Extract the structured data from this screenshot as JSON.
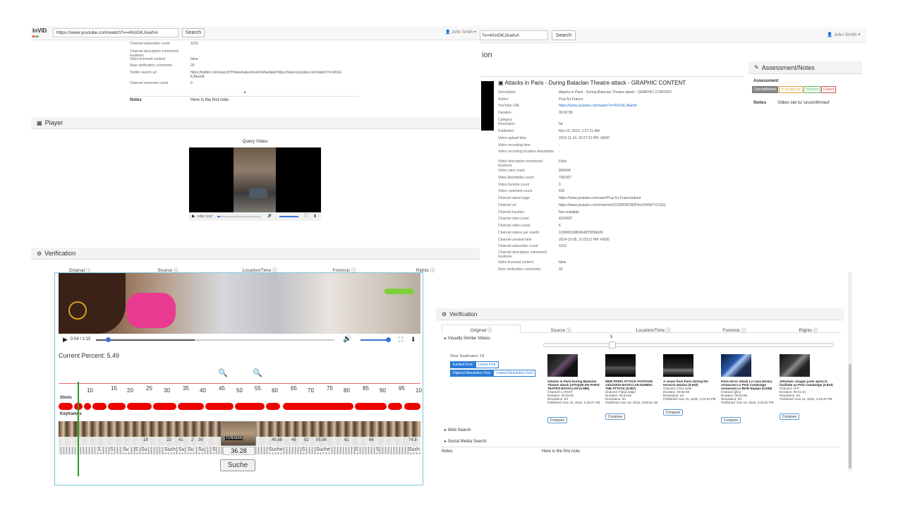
{
  "topbar": {
    "logo": "InVID",
    "url_value": "https://www.youtube.com/watch?v=4XnGKJAarhA",
    "search_label": "Search",
    "user": "John Smith"
  },
  "left_meta": {
    "rows": [
      {
        "k": "Channel subscriber count",
        "v": "1103"
      },
      {
        "k": "Channel description mentioned locations",
        "v": ""
      },
      {
        "k": "Video licensed content",
        "v": "false"
      },
      {
        "k": "Num verification comments",
        "v": "20"
      },
      {
        "k": "Twitter search url",
        "v": "https://twitter.com/search?f=tweets&vertical=default&q=https://www.youtube.com/watch?v=4XnGKJAarhA"
      },
      {
        "k": "Channel comment count",
        "v": "0"
      }
    ],
    "notes_label": "Notes",
    "notes_value": "Here is the first note."
  },
  "player": {
    "title": "Player",
    "caption": "Query Video",
    "time": "0:00 / 2:57"
  },
  "verification_left": {
    "title": "Verification",
    "tabs": [
      "Original",
      "Source",
      "Location/Time",
      "Forensic",
      "Rights"
    ]
  },
  "zoom": {
    "player_time": "0:04 / 1:15",
    "current_percent_label": "Current Percent: 5.49",
    "ruler": [
      "10",
      "15",
      "20",
      "25",
      "30",
      "35",
      "40",
      "45",
      "50",
      "55",
      "60",
      "65",
      "70",
      "75",
      "80",
      "85",
      "90",
      "95",
      "10"
    ],
    "shots_label": "Shots",
    "keyframes_label": "Keyframes",
    "frame_numbers": [
      "18",
      "23",
      "41",
      "2",
      "30",
      "36.28",
      "45.88",
      "49",
      "52",
      "55.56",
      "61",
      "66",
      "74.8"
    ],
    "tooltip_value": "36.28",
    "suche_label": "Suche",
    "tunisian": "TUNISIAN",
    "strip_labels": [
      "S",
      "S",
      "Su",
      "S",
      "Su",
      "Such",
      "Su",
      "Su",
      "Su",
      "S",
      "Suche",
      "S",
      "Suche",
      "S",
      "S",
      "Such"
    ]
  },
  "right_top": {
    "url_value": "?v=4XnGKJAarhA",
    "search_label": "Search",
    "user": "John Smith",
    "section_fragment": "ion"
  },
  "video_details": {
    "title": "Attacks in Paris - During Bataclan Theatre attack - GRAPHIC CONTENT",
    "rows": [
      {
        "k": "Description",
        "v": "Attacks in Paris - During Bataclan Theatre attack - GRAPHIC CONTENT"
      },
      {
        "k": "Author",
        "v": "Pray for France"
      },
      {
        "k": "YouTube URL",
        "v": "https://www.youtube.com/watch?v=4XnGKJAarhA"
      },
      {
        "k": "Duration",
        "v": "00:02:58"
      },
      {
        "k": "Category",
        "v": ""
      },
      {
        "k": "Resolution",
        "v": "hd"
      },
      {
        "k": "Published",
        "v": "Nov 15, 2015, 1:27:21 AM"
      },
      {
        "k": "Video upload time",
        "v": "2015-11-14, 23:27:21 PM +0000"
      },
      {
        "k": "Video recording time",
        "v": "-"
      },
      {
        "k": "Video recording location description",
        "v": "-"
      },
      {
        "k": "Video description mentioned locations",
        "v": "Paris"
      },
      {
        "k": "Video view count",
        "v": "856044"
      },
      {
        "k": "Video like/dislike count",
        "v": "706/307"
      },
      {
        "k": "Video favorite count",
        "v": "0"
      },
      {
        "k": "Video comment count",
        "v": "432"
      },
      {
        "k": "Channel about page",
        "v": "https://www.youtube.com/user/Pray for France/about"
      },
      {
        "k": "Channel url",
        "v": "https://www.youtube.com/channel/UC0t2KW2302HoxXW3tt7YCLEQ"
      },
      {
        "k": "Channel location",
        "v": "Not available"
      },
      {
        "k": "Channel view count",
        "v": "4324437"
      },
      {
        "k": "Channel video count",
        "v": "6"
      },
      {
        "k": "Channel videos per month",
        "v": "0.000010980664879258439"
      },
      {
        "k": "Channel created time",
        "v": "2014-12-05, 21:03:11 PM +0000"
      },
      {
        "k": "Channel subscriber count",
        "v": "1103"
      },
      {
        "k": "Channel description mentioned locations",
        "v": ""
      },
      {
        "k": "Video licensed content",
        "v": "false"
      },
      {
        "k": "Num verification comments",
        "v": "20"
      }
    ],
    "mini_time": "0:00 / 2:57"
  },
  "assessment": {
    "title": "Assessment/Notes",
    "label": "Assessment",
    "options": [
      "Unconfirmed",
      "In progress",
      "Verified",
      "Faked"
    ],
    "notes_label": "Notes",
    "notes_value": "Video set to 'unconfirmed'"
  },
  "verification_right": {
    "title": "Verification",
    "tabs": [
      "Original",
      "Source",
      "Location/Time",
      "Forensic",
      "Rights"
    ],
    "similar_label": "Visually Similar Videos",
    "slider_value": "5",
    "near_duplicates": "Near Duplicates: 18",
    "sort_buttons": [
      "Earliest First",
      "Latest First",
      "Highest Resolution First",
      "Lowest Resolution First"
    ],
    "cards": [
      {
        "title": "Attacks in Paris During Bataclan Theatre attack (ATAQUE EN PARIS TEATRO BATACLAN (0.986)",
        "channel": "Channel: LATEST",
        "duration": "Duration: 00:03:02",
        "resolution": "Resolution: hd",
        "published": "Published: Nov 22, 2015, 1:25:07 AM",
        "compare": "Compare"
      },
      {
        "title": "NEW PARIS ATTACK FOOTAGE 13/11/2015 BATACLAN DURING THE ATTACK (0.967)",
        "channel": "Channel: Fakid Zalaj+",
        "duration": "Duration: 00:02:58",
        "resolution": "Resolution: hd",
        "published": "Published: Nov 15, 2015, 3:59:54 AM",
        "compare": "Compare"
      },
      {
        "title": "A scene from Paris during the terrorist attacks (0.932)",
        "channel": "Channel: Chris Hale",
        "duration": "Duration: 00:02:58",
        "resolution": "Resolution: sd",
        "published": "Published: Nov 15, 2015, 4:21:33 PM",
        "compare": "Compare"
      },
      {
        "title": "Paris terror attack La Casa Nostra restaurant Le Petit Cambodge restaurant La Belle Equipe (0.838)",
        "channel": "Channel: jjlleo",
        "duration": "Duration: 00:01:56",
        "resolution": "Resolution: hd",
        "published": "Published: Nov 16, 2015, 4:46:22 PM",
        "compare": "Compare"
      },
      {
        "title": "Attentats: images juste après la fusillade au Petit Cambodge (0.834)",
        "channel": "Channel: AFP",
        "duration": "Duration: 00:01:10",
        "resolution": "Resolution: hd",
        "published": "Published: Nov 14, 2015, 4:10:42 PM",
        "compare": "Compare"
      }
    ],
    "web_search": "Web Search",
    "social_search": "Social Media Search",
    "notes_label": "Notes",
    "notes_value": "Here is the first note."
  }
}
